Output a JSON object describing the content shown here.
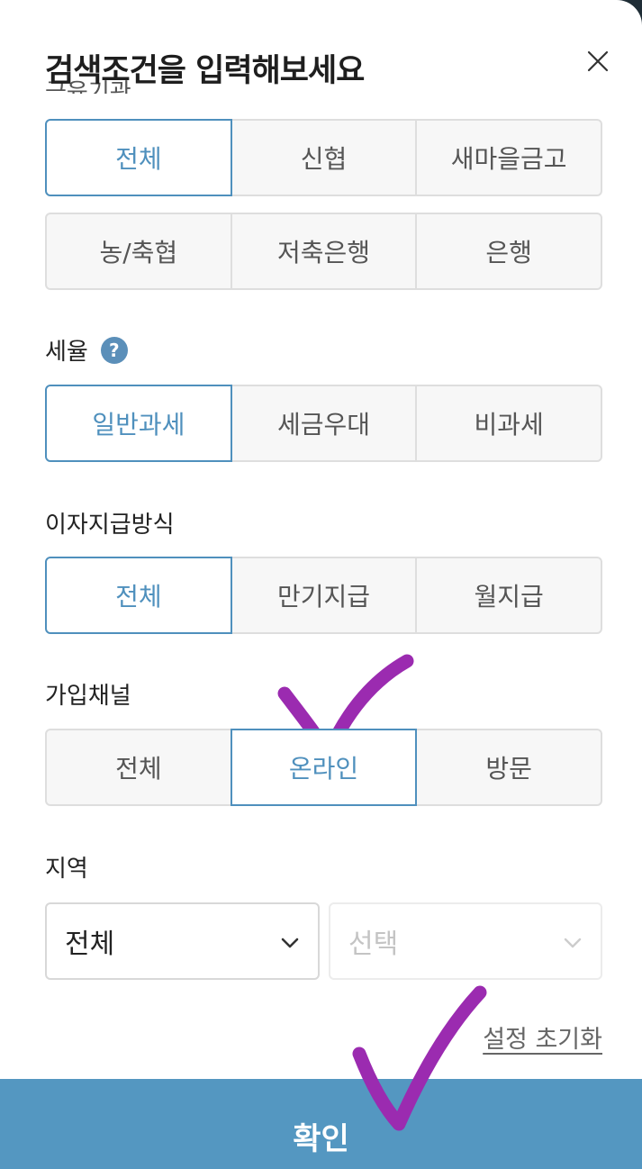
{
  "modal": {
    "title": "검색조건을 입력해보세요",
    "partial_label": "금융기관"
  },
  "institution": {
    "row1": [
      "전체",
      "신협",
      "새마을금고"
    ],
    "row2": [
      "농/축협",
      "저축은행",
      "은행"
    ],
    "selected": "전체"
  },
  "tax": {
    "label": "세율",
    "help_icon": "question-circle-icon",
    "help_glyph": "?",
    "options": [
      "일반과세",
      "세금우대",
      "비과세"
    ],
    "selected": "일반과세"
  },
  "interest": {
    "label": "이자지급방식",
    "options": [
      "전체",
      "만기지급",
      "월지급"
    ],
    "selected": "전체"
  },
  "channel": {
    "label": "가입채널",
    "options": [
      "전체",
      "온라인",
      "방문"
    ],
    "selected": "온라인"
  },
  "region": {
    "label": "지역",
    "primary_value": "전체",
    "secondary_placeholder": "선택"
  },
  "footer": {
    "reset_label": "설정 초기화",
    "confirm_label": "확인"
  },
  "colors": {
    "accent": "#4f90bd",
    "confirm_bg": "#5497c1",
    "annotation": "#9b2bb0"
  }
}
